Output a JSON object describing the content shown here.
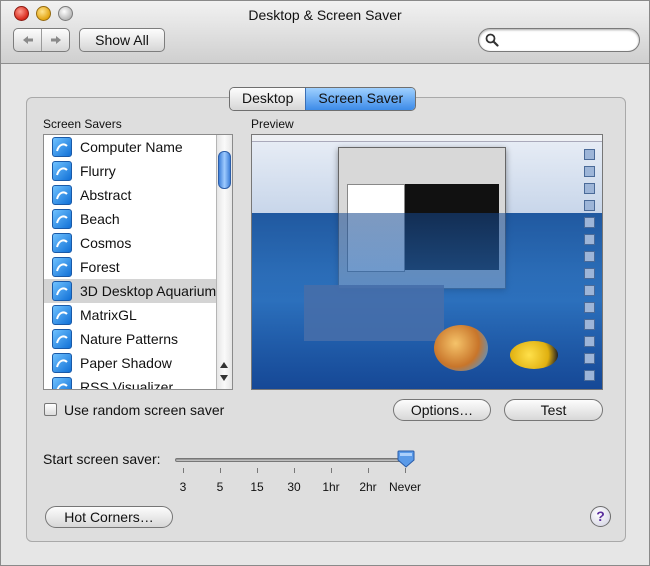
{
  "window": {
    "title": "Desktop & Screen Saver",
    "show_all": "Show All",
    "search_placeholder": ""
  },
  "tabs": [
    {
      "label": "Desktop",
      "active": false
    },
    {
      "label": "Screen Saver",
      "active": true
    }
  ],
  "screen_savers": {
    "heading": "Screen Savers",
    "items": [
      {
        "label": "Computer Name",
        "selected": false
      },
      {
        "label": "Flurry",
        "selected": false
      },
      {
        "label": "Abstract",
        "selected": false
      },
      {
        "label": "Beach",
        "selected": false
      },
      {
        "label": "Cosmos",
        "selected": false
      },
      {
        "label": "Forest",
        "selected": false
      },
      {
        "label": "3D Desktop Aquarium",
        "selected": true
      },
      {
        "label": "MatrixGL",
        "selected": false
      },
      {
        "label": "Nature Patterns",
        "selected": false
      },
      {
        "label": "Paper Shadow",
        "selected": false
      },
      {
        "label": "RSS Visualizer",
        "selected": false
      }
    ]
  },
  "preview": {
    "heading": "Preview"
  },
  "controls": {
    "random_label": "Use random screen saver",
    "random_checked": false,
    "options_label": "Options…",
    "test_label": "Test",
    "start_label": "Start screen saver:",
    "slider_ticks": [
      "3",
      "5",
      "15",
      "30",
      "1hr",
      "2hr",
      "Never"
    ],
    "slider_value": "Never",
    "hot_corners_label": "Hot Corners…",
    "help_label": "?"
  },
  "colors": {
    "accent": "#3d8be8",
    "selection": "#d4d4d4"
  }
}
